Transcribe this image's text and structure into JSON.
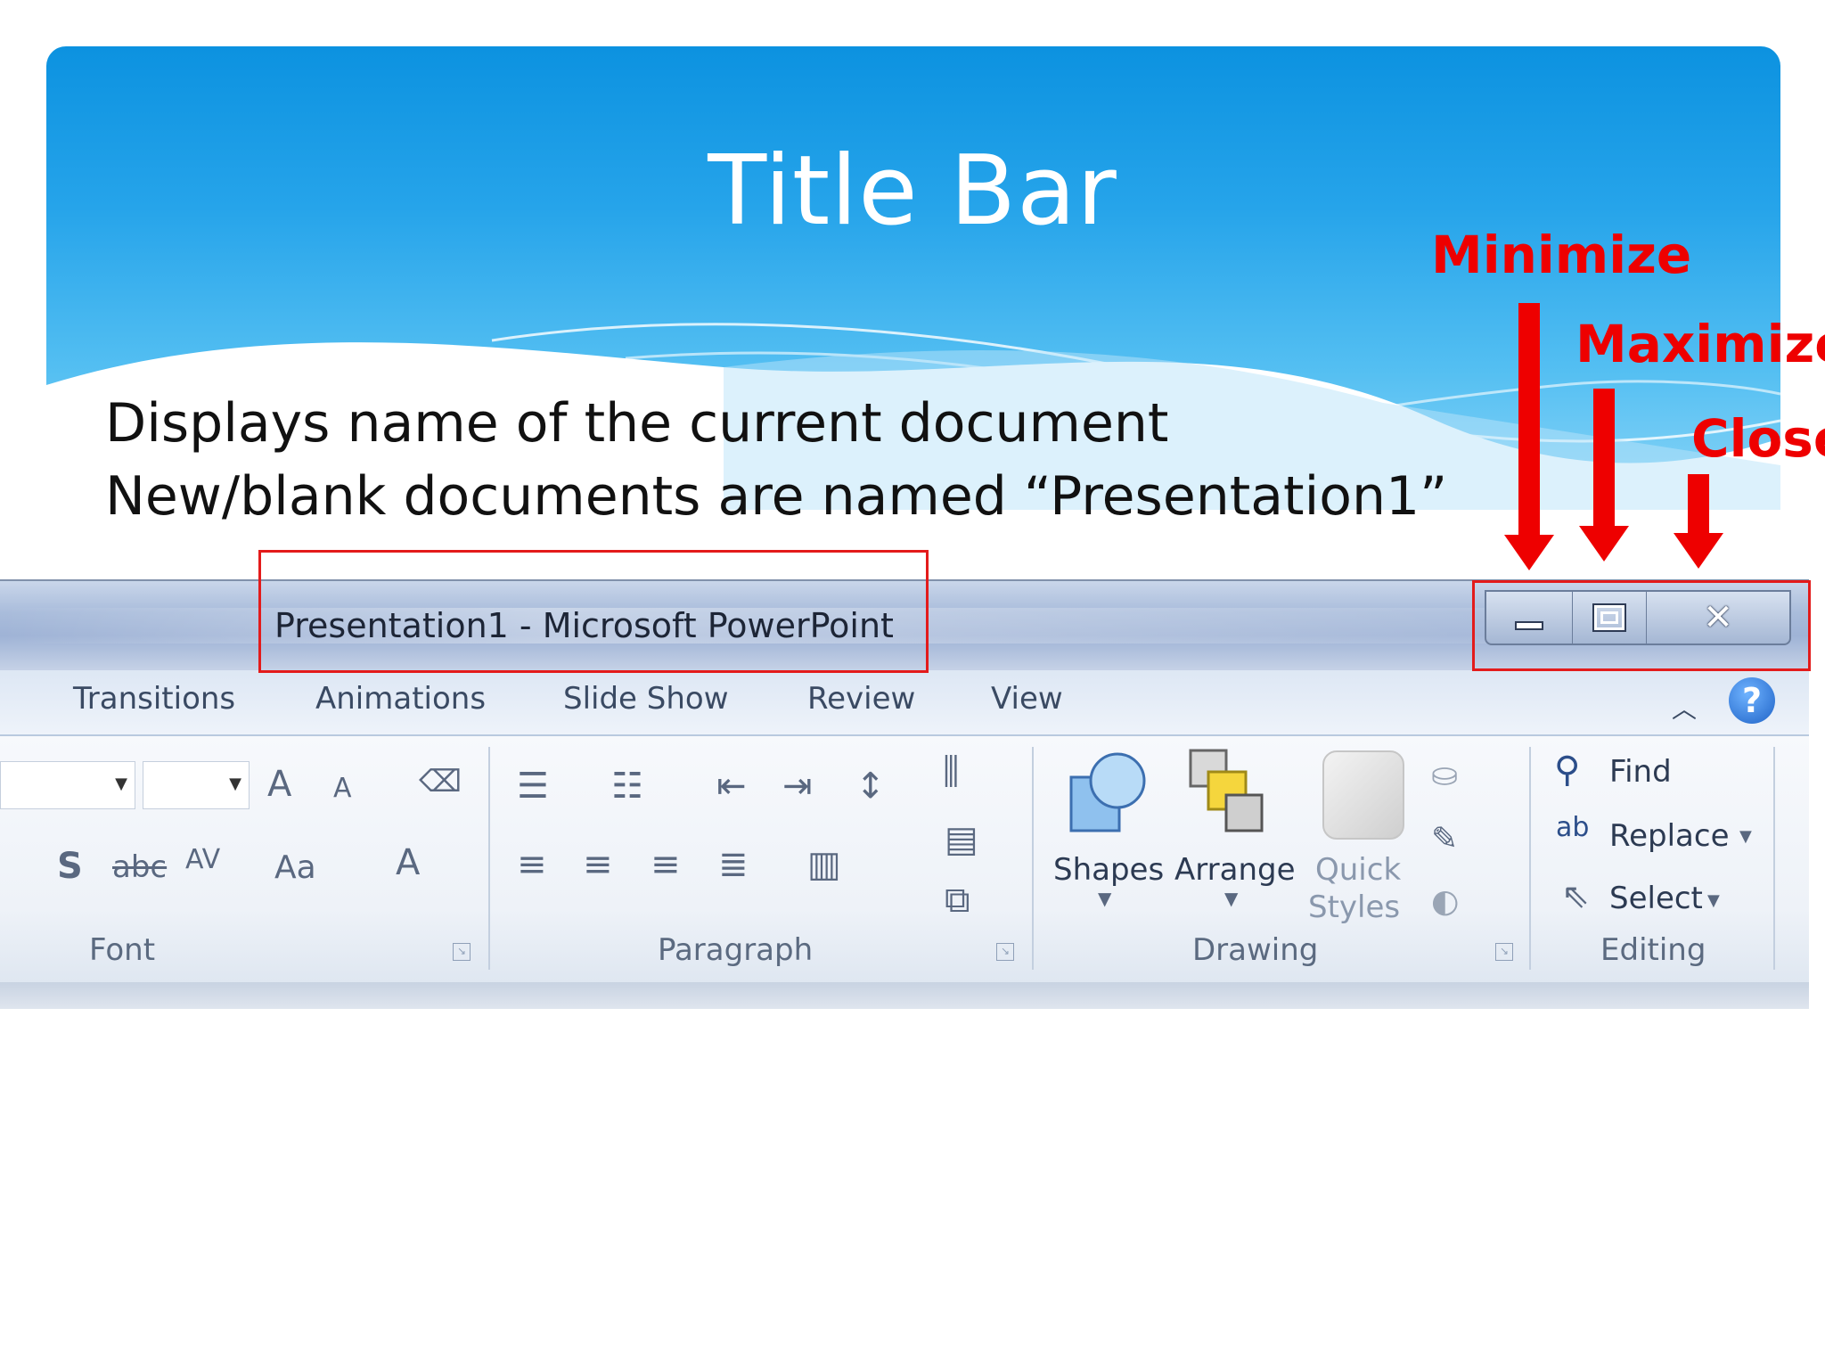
{
  "slide": {
    "title": "Title Bar",
    "body_lines": [
      "Displays name of the current document",
      "New/blank documents are named “Presentation1”"
    ]
  },
  "annotations": {
    "minimize": "Minimize",
    "maximize": "Maximize",
    "close": "Close",
    "color": "#ee0000"
  },
  "window": {
    "title": "Presentation1  -  Microsoft PowerPoint",
    "controls": [
      "minimize-icon",
      "maximize-icon",
      "close-icon"
    ],
    "tabs": [
      "Transitions",
      "Animations",
      "Slide Show",
      "Review",
      "View"
    ],
    "help": "?"
  },
  "ribbon": {
    "groups": [
      {
        "label": "Font",
        "controls": [
          "A",
          "A",
          "S",
          "abc",
          "AV",
          "Aa",
          "A"
        ]
      },
      {
        "label": "Paragraph"
      },
      {
        "label": "Drawing",
        "buttons": [
          "Shapes",
          "Arrange",
          "Quick",
          "Styles"
        ]
      },
      {
        "label": "Editing",
        "buttons": [
          "Find",
          "Replace",
          "Select"
        ]
      }
    ]
  }
}
